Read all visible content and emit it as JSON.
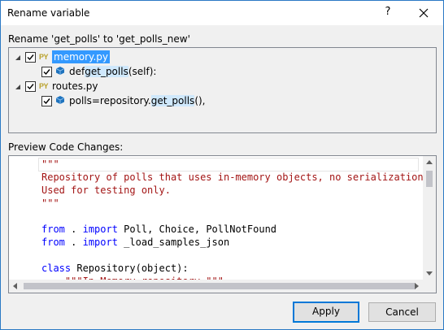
{
  "window": {
    "title": "Rename variable",
    "help": "?"
  },
  "tree": {
    "label": "Rename 'get_polls' to 'get_polls_new'",
    "items": [
      {
        "badge": "PY",
        "label": "memory.py"
      },
      {
        "pre": "def ",
        "match": "get_polls",
        "post": "(self):"
      },
      {
        "badge": "PY",
        "label": "routes.py"
      },
      {
        "pre": "polls=repository.",
        "match": "get_polls",
        "post": "(),"
      }
    ]
  },
  "preview": {
    "label": "Preview Code Changes:",
    "lines": [
      "\"\"\"",
      "Repository of polls that uses in-memory objects, no serialization.",
      "Used for testing only.",
      "\"\"\"",
      "",
      "from . import Poll, Choice, PollNotFound",
      "from . import _load_samples_json",
      "",
      "class Repository(object):",
      "    \"\"\"In-Memory repository \"\"\""
    ],
    "tokens": {
      "from1": "from",
      "dot1": " . ",
      "import1": "import",
      "rest1": " Poll, Choice, PollNotFound",
      "from2": "from",
      "dot2": " . ",
      "import2": "import",
      "rest2": " _load_samples_json",
      "class": "class",
      "classrest": " Repository(object):",
      "indent": "    "
    }
  },
  "buttons": {
    "apply": "Apply",
    "cancel": "Cancel"
  },
  "colors": {
    "string": "#a31515",
    "keyword": "#0000ff",
    "selection": "#3399ff",
    "highlight": "#cfe8fc"
  }
}
